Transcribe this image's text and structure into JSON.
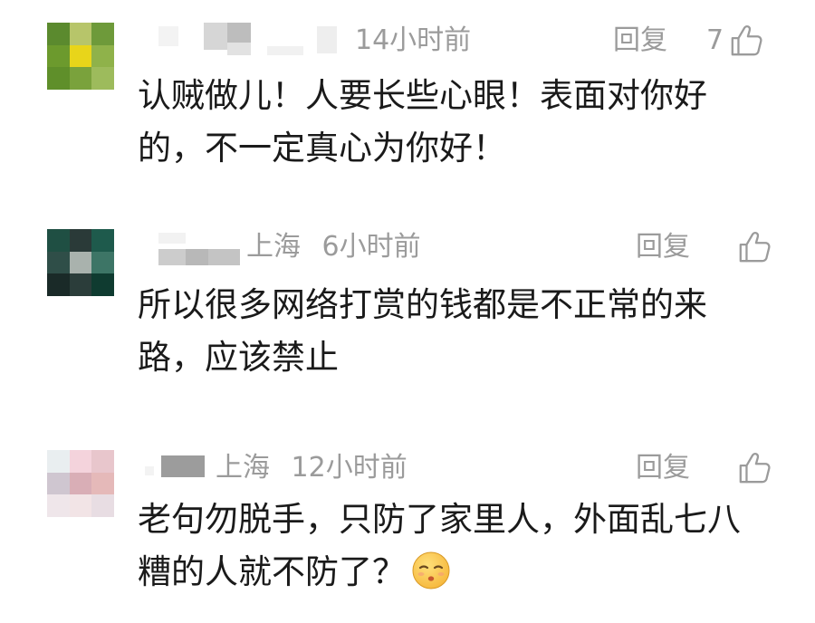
{
  "comments": [
    {
      "location": "",
      "time": "14小时前",
      "reply_label": "回复",
      "like_count": "7",
      "text_line1": "认贼做儿！人要长些心眼！表面对你好",
      "text_line2": "的，不一定真心为你好！",
      "avatar_colors": [
        "#5b8a2e",
        "#b7c56a",
        "#6e9a3a",
        "#6c9a2d",
        "#e8d51a",
        "#8fb24a",
        "#5f8f2a",
        "#7aa23c",
        "#9dbb5c"
      ]
    },
    {
      "location": "上海",
      "time": "6小时前",
      "reply_label": "回复",
      "like_count": "",
      "text_line1": "所以很多网络打赏的钱都是不正常的来",
      "text_line2": "路，应该禁止",
      "avatar_colors": [
        "#1f4f43",
        "#2a3a38",
        "#1e5a4c",
        "#2f4e48",
        "#a9b2ad",
        "#3d7566",
        "#1a2a28",
        "#2b3d3a",
        "#0f3b30"
      ]
    },
    {
      "location": "上海",
      "time": "12小时前",
      "reply_label": "回复",
      "like_count": "",
      "text_line1": "老句勿脱手，只防了家里人，外面乱七八",
      "text_line2": "糟的人就不防了？",
      "emoji": "shushing-face-emoji",
      "avatar_colors": [
        "#e9eef0",
        "#f4d3dc",
        "#e8c6cc",
        "#cfc6d0",
        "#d9aeb6",
        "#e5b9b9",
        "#efe6ea",
        "#f2e4e6",
        "#e8dde3"
      ]
    }
  ],
  "icons": {
    "like": "thumbs-up-outline-icon"
  },
  "colors": {
    "meta_gray": "#9b9b9b",
    "text": "#1a1a1a"
  }
}
